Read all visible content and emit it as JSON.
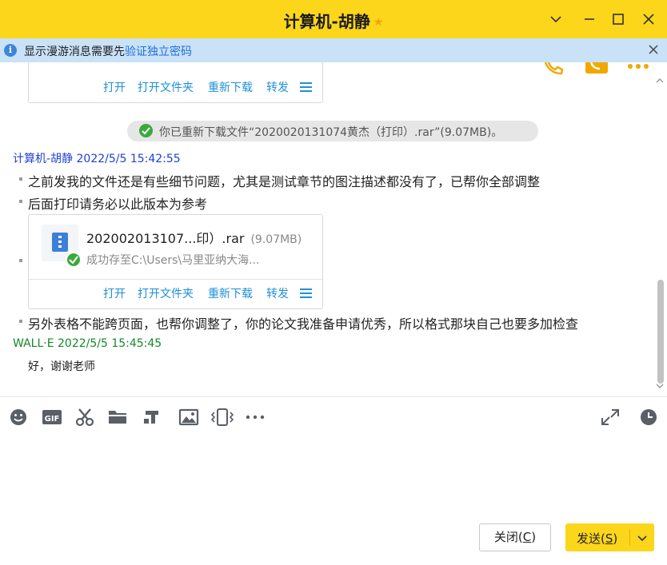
{
  "window": {
    "title": "计算机-胡静",
    "title_badge": "★",
    "accent_color": "#fcd61a"
  },
  "infobar": {
    "text_prefix": "显示漫游消息需要先",
    "link_text": "验证独立密码",
    "icon": "info-icon"
  },
  "chat": {
    "previous_card_actions": [
      "打开",
      "打开文件夹",
      "重新下载",
      "转发"
    ],
    "system_message": "你已重新下载文件“2020020131074黄杰（打印）.rar”(9.07MB)。",
    "messages": [
      {
        "sender": "计算机-胡静 2022/5/5 15:42:55",
        "lines": [
          "之前发我的文件还是有些细节问题，尤其是测试章节的图注描述都没有了，已帮你全部调整",
          "后面打印请务必以此版本为参考"
        ],
        "file": {
          "name": "202002013107...印）.rar",
          "size": "(9.07MB)",
          "status": "成功存至C:\\Users\\马里亚纳大海...",
          "actions": [
            "打开",
            "打开文件夹",
            "重新下载",
            "转发"
          ]
        },
        "after_file": "另外表格不能跨页面，也帮你调整了，你的论文我准备申请优秀，所以格式那块自己也要多加检查"
      },
      {
        "sender": "WALL·E 2022/5/5 15:45:45",
        "lines": [
          "好，谢谢老师"
        ]
      }
    ]
  },
  "toolbar": {
    "left_icons": [
      "emoji-icon",
      "gif-icon",
      "scissors-icon",
      "folder-icon",
      "font-icon",
      "image-icon",
      "shake-icon",
      "more-icon"
    ],
    "right_icons": [
      "expand-icon",
      "history-icon"
    ]
  },
  "footer": {
    "close_label": "关闭(",
    "close_key": "C",
    "close_tail": ")",
    "send_label": "发送(",
    "send_key": "S",
    "send_tail": ")"
  }
}
